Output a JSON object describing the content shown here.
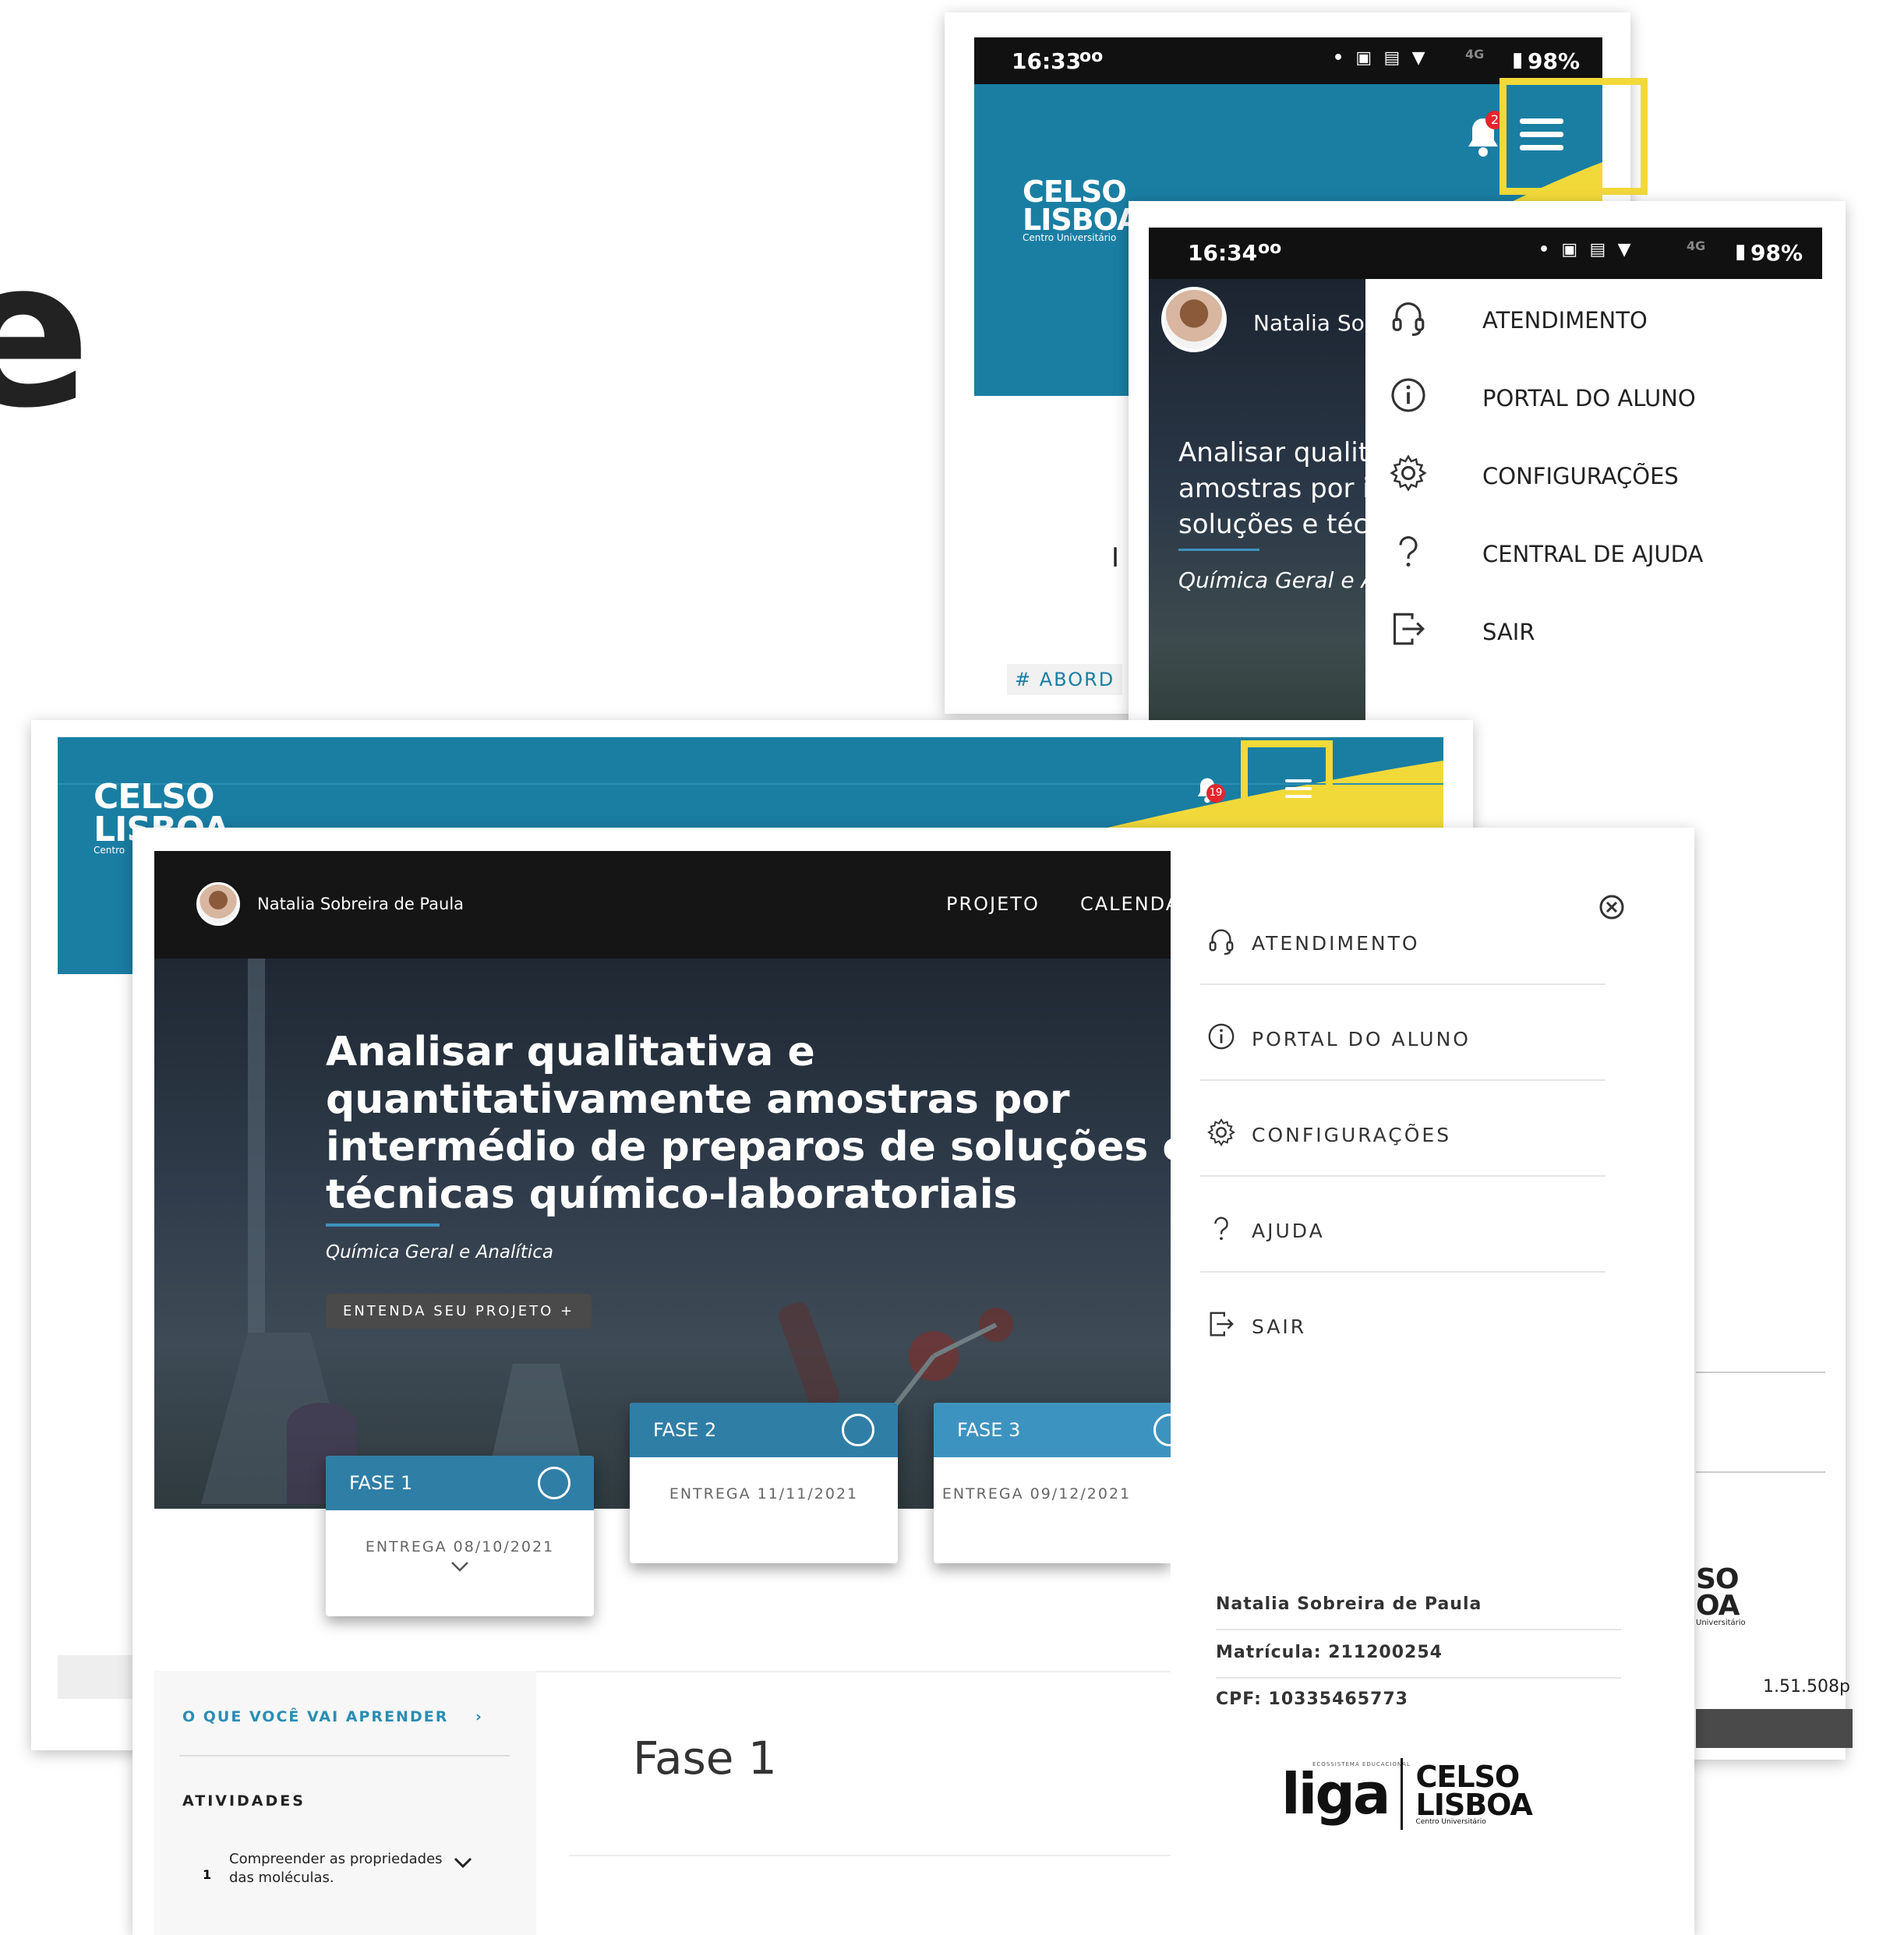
{
  "background_heading_fragment": "e",
  "phone1": {
    "time": "16:33",
    "voicemail": "oo",
    "battery": "98%",
    "signal": "4G",
    "notif_count": "2",
    "logo_line1": "CELSO",
    "logo_line2": "LISBOA",
    "logo_sub": "Centro Universitário",
    "tag_text": "# ABORD"
  },
  "phone2": {
    "time": "16:34",
    "voicemail": "oo",
    "battery": "98%",
    "signal": "4G",
    "user_name": "Natalia Sob",
    "hero_line1": "Analisar qualit",
    "hero_line2": "amostras por i",
    "hero_line3": "soluções e técn",
    "course": "Química Geral e A",
    "menu": [
      {
        "label": "ATENDIMENTO",
        "icon": "headset-icon"
      },
      {
        "label": "PORTAL DO ALUNO",
        "icon": "info-icon"
      },
      {
        "label": "CONFIGURAÇÕES",
        "icon": "gear-icon"
      },
      {
        "label": "CENTRAL DE AJUDA",
        "icon": "help-icon"
      },
      {
        "label": "SAIR",
        "icon": "logout-icon"
      }
    ]
  },
  "desktop_bg": {
    "logo_line1": "CELSO",
    "logo_line2": "LISBOA",
    "logo_sub": "Centro",
    "notif_count": "19",
    "right_logo_1": "SO",
    "right_logo_2": "OA",
    "right_logo_sub": "Universitário",
    "size_text": "1.51.508p"
  },
  "desktop": {
    "user_name": "Natalia Sobreira de Paula",
    "nav": [
      "PROJETO",
      "CALENDA"
    ],
    "hero_title_lines": [
      "Analisar qualitativa e",
      "quantitativamente amostras por",
      "intermédio de preparos de soluções e",
      "técnicas químico-laboratoriais"
    ],
    "course": "Química Geral e Analítica",
    "cta": "ENTENDA SEU PROJETO +",
    "phases": [
      {
        "title": "FASE 1",
        "date": "ENTREGA 08/10/2021"
      },
      {
        "title": "FASE 2",
        "date": "ENTREGA 11/11/2021"
      },
      {
        "title": "FASE 3",
        "date": "ENTREGA 09/12/2021"
      }
    ],
    "learn_link": "O QUE VOCÊ VAI APRENDER",
    "activities_title": "ATIVIDADES",
    "activity_num": "1",
    "activity_text_1": "Compreender as propriedades",
    "activity_text_2": "das moléculas.",
    "phase_heading": "Fase 1"
  },
  "panel": {
    "menu": [
      {
        "label": "ATENDIMENTO",
        "icon": "headset-icon"
      },
      {
        "label": "PORTAL DO ALUNO",
        "icon": "info-icon"
      },
      {
        "label": "CONFIGURAÇÕES",
        "icon": "gear-icon"
      },
      {
        "label": "AJUDA",
        "icon": "help-icon"
      },
      {
        "label": "SAIR",
        "icon": "logout-icon"
      }
    ],
    "name": "Natalia Sobreira de Paula",
    "matricula": "Matrícula: 211200254",
    "cpf": "CPF: 10335465773",
    "footer_logo_liga": "liga",
    "footer_logo_small": "ECOSSISTEMA EDUCACIONAL",
    "footer_logo_line1": "CELSO",
    "footer_logo_line2": "LISBOA",
    "footer_logo_sub": "Centro Universitário"
  },
  "colors": {
    "teal": "#1a7ea3",
    "yellow_highlight": "#f2d93a",
    "phase_blue": "#2f7ea6",
    "phase_blue_light": "#3d93bf",
    "dark_bar": "#111111"
  }
}
